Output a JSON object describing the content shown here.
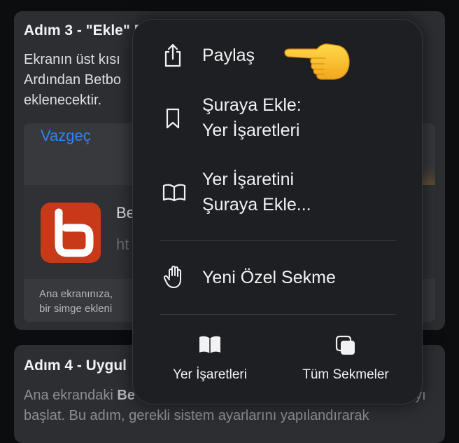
{
  "background": {
    "step3": {
      "title": "Adım 3 - \"Ekle\" B",
      "lines": [
        "Ekranın üst kısı",
        "Ardından Betbo",
        "eklenecektir."
      ]
    },
    "screenshot": {
      "cancel": "Vazgeç",
      "app_name": "Be",
      "url": "ht",
      "footer_lines": [
        "Ana ekranınıza,",
        "bir simge ekleni"
      ]
    },
    "step4": {
      "title": "Adım 4 - Uygul",
      "line1_pre": "Ana ekrandaki ",
      "line1_bold": "Be",
      "line1_tail": "ayı",
      "line2": "başlat. Bu adım, gerekli sistem ayarlarını yapılandırarak"
    }
  },
  "menu": {
    "share": "Paylaş",
    "add_to_line1": "Şuraya Ekle:",
    "add_to_line2": "Yer İşaretleri",
    "add_bookmark_line1": "Yer İşaretini",
    "add_bookmark_line2": "Şuraya Ekle...",
    "private_tab": "Yeni Özel Sekme",
    "bookmarks": "Yer İşaretleri",
    "all_tabs": "Tüm Sekmeler"
  },
  "icons": {
    "share": "share-icon",
    "bookmark": "bookmark-icon",
    "book": "book-icon",
    "hand": "hand-icon",
    "tabs": "tabs-icon",
    "pointing": "pointing-hand-emoji"
  },
  "colors": {
    "accent": "#2f84f4",
    "menu_bg": "#1e1f22",
    "app_icon": "#c8391a"
  }
}
